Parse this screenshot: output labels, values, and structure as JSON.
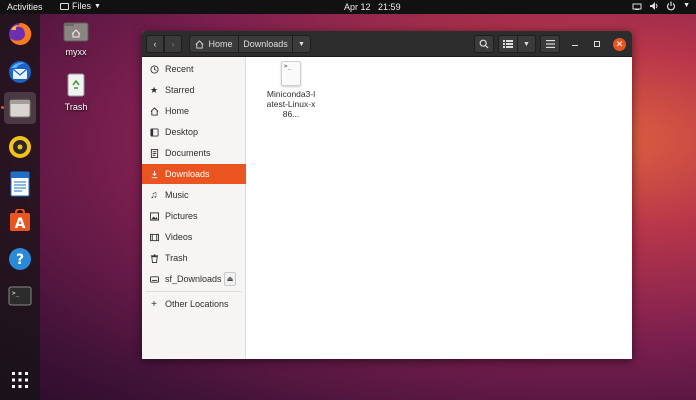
{
  "topbar": {
    "activities": "Activities",
    "app_menu": "Files",
    "date": "Apr 12",
    "time": "21:59"
  },
  "desktop": {
    "icons": [
      {
        "label": "myxx",
        "icon": "home-folder-icon"
      },
      {
        "label": "Trash",
        "icon": "trash-icon"
      }
    ]
  },
  "dock": {
    "items": [
      "firefox-icon",
      "thunderbird-icon",
      "files-icon",
      "rhythmbox-icon",
      "libreoffice-writer-icon",
      "software-center-icon",
      "help-icon",
      "terminal-icon",
      "show-apps-icon"
    ],
    "active": "files-icon"
  },
  "window": {
    "breadcrumb": {
      "home": "Home",
      "current": "Downloads"
    },
    "sidebar": {
      "items": [
        {
          "label": "Recent",
          "icon": "clock-icon"
        },
        {
          "label": "Starred",
          "icon": "star-icon"
        },
        {
          "label": "Home",
          "icon": "home-icon"
        },
        {
          "label": "Desktop",
          "icon": "desktop-icon"
        },
        {
          "label": "Documents",
          "icon": "document-icon"
        },
        {
          "label": "Downloads",
          "icon": "download-icon"
        },
        {
          "label": "Music",
          "icon": "music-icon"
        },
        {
          "label": "Pictures",
          "icon": "picture-icon"
        },
        {
          "label": "Videos",
          "icon": "video-icon"
        },
        {
          "label": "Trash",
          "icon": "trash-icon"
        },
        {
          "label": "sf_Downloads",
          "icon": "drive-icon"
        },
        {
          "label": "Other Locations",
          "icon": "plus-icon"
        }
      ],
      "active": "Downloads"
    },
    "files": [
      {
        "name": "Miniconda3-latest-Linux-x86...",
        "thumb_text": ">_",
        "icon": "script-file-icon"
      }
    ]
  },
  "colors": {
    "accent": "#e95420",
    "headerbar": "#2d2d2d",
    "sidebar": "#f6f5f4"
  }
}
